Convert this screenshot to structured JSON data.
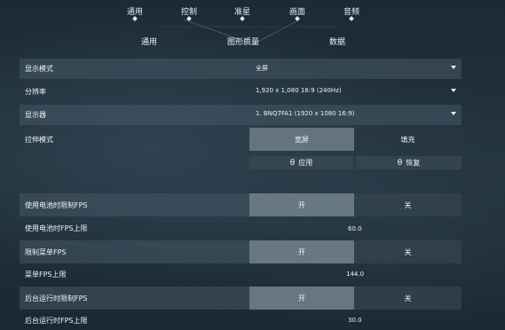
{
  "top_nav": [
    {
      "label": "通用"
    },
    {
      "label": "控制"
    },
    {
      "label": "准星"
    },
    {
      "label": "画面"
    },
    {
      "label": "音频"
    }
  ],
  "sub_tabs": [
    {
      "label": "通用"
    },
    {
      "label": "图形质量"
    },
    {
      "label": "数据"
    }
  ],
  "settings": {
    "display_mode": {
      "label": "显示模式",
      "value": "全屏"
    },
    "resolution": {
      "label": "分辨率",
      "value": "1,920 x 1,080 16:9 (240Hz)"
    },
    "monitor": {
      "label": "显示器",
      "value": "1. BNQ7FA1 (1920 x 1080 16:9)"
    },
    "stretch_mode": {
      "label": "拉伸模式",
      "option_a": "宽屏",
      "option_b": "填充",
      "selected": "宽屏"
    },
    "apply_label": "应用",
    "restore_label": "恢复",
    "battery_limit_fps": {
      "label": "使用电池时限制FPS",
      "on": "开",
      "off": "关",
      "selected": "开"
    },
    "battery_fps_cap": {
      "label": "使用电池时FPS上限",
      "value": "60.0"
    },
    "menu_limit_fps": {
      "label": "限制菜单FPS",
      "on": "开",
      "off": "关",
      "selected": "开"
    },
    "menu_fps_cap": {
      "label": "菜单FPS上限",
      "value": "144.0"
    },
    "background_limit_fps": {
      "label": "后台运行时限制FPS",
      "on": "开",
      "off": "关",
      "selected": "开"
    },
    "background_fps_cap": {
      "label": "后台运行时FPS上限",
      "value": "30.0"
    }
  },
  "colors": {
    "accent_text": "#eef2f4",
    "selected_segment": "#78889280",
    "row_background": "#46586480"
  },
  "icons": {
    "apply": "lock-icon",
    "restore": "lock-icon"
  }
}
